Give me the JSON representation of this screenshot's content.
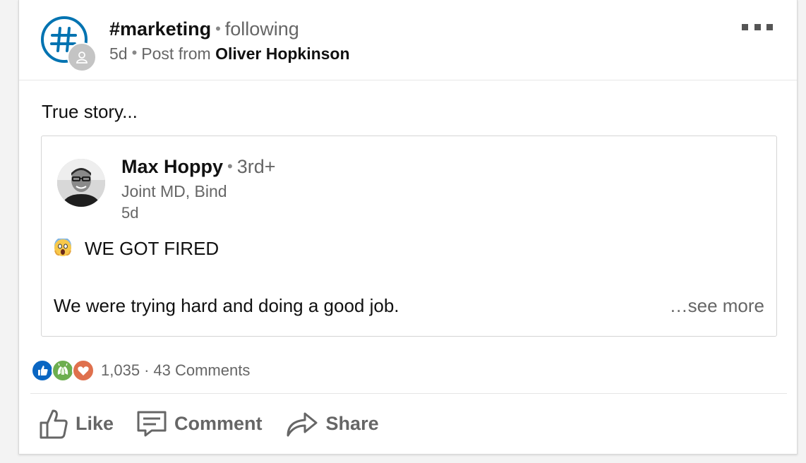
{
  "header": {
    "hashtag": "#marketing",
    "follow_status": "following",
    "age": "5d",
    "post_from_prefix": "Post from",
    "author": "Oliver Hopkinson"
  },
  "commentary": "True story...",
  "shared_post": {
    "name": "Max Hoppy",
    "degree": "3rd+",
    "headline": "Joint MD, Bind",
    "age": "5d",
    "line1_emoji": "face-screaming-in-fear",
    "line1": "WE GOT FIRED",
    "line2": "We were trying hard and doing a good job.",
    "see_more": "…see more"
  },
  "social": {
    "reactions": [
      "like",
      "celebrate",
      "love"
    ],
    "reaction_count": "1,035",
    "separator": "·",
    "comments": "43 Comments"
  },
  "actions": {
    "like": "Like",
    "comment": "Comment",
    "share": "Share"
  },
  "colors": {
    "hashtag_blue": "#0073b1",
    "like_blue": "#0a66c2",
    "celebrate_green": "#6dae4f",
    "love_orange": "#df704d"
  }
}
